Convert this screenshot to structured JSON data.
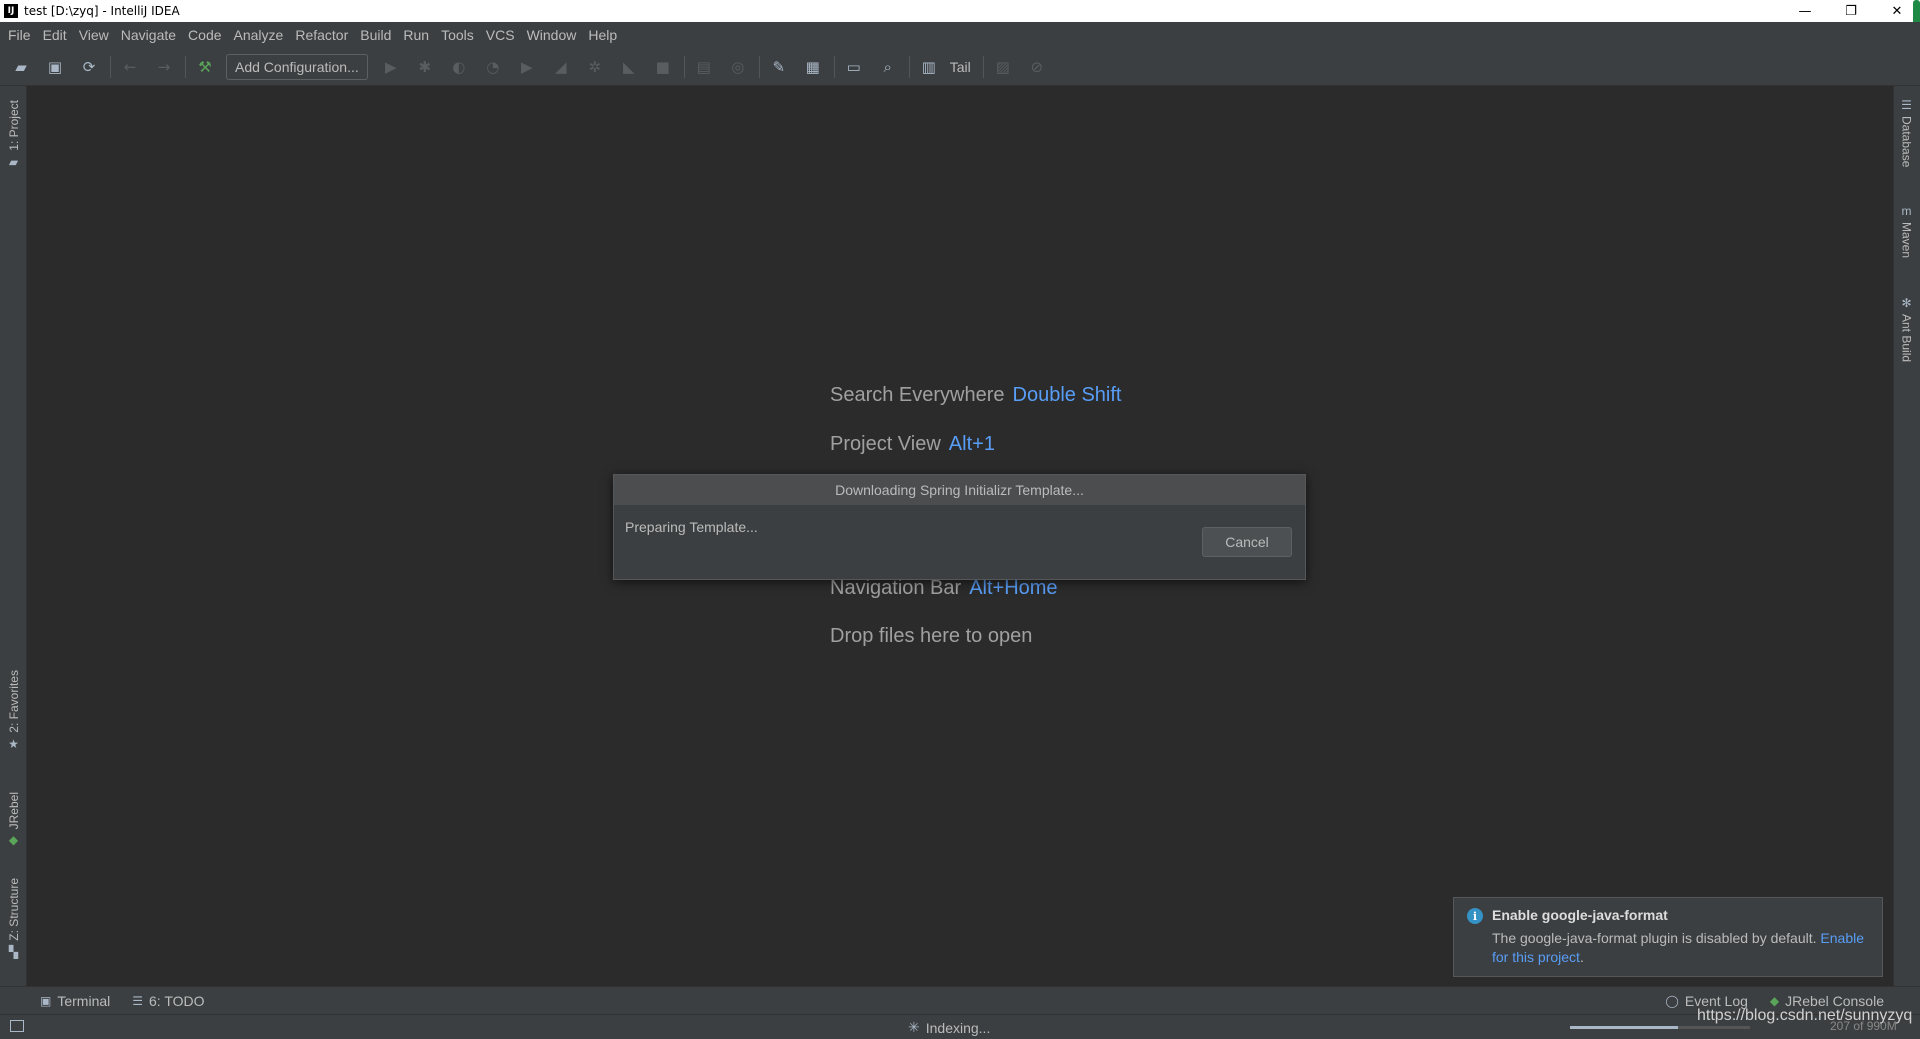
{
  "window": {
    "title": "test [D:\\zyq] - IntelliJ IDEA",
    "app_icon_label": "IJ",
    "minimize": "—",
    "restore": "❐",
    "close": "✕"
  },
  "menu": [
    "File",
    "Edit",
    "View",
    "Navigate",
    "Code",
    "Analyze",
    "Refactor",
    "Build",
    "Run",
    "Tools",
    "VCS",
    "Window",
    "Help"
  ],
  "toolbar": {
    "config_label": "Add Configuration...",
    "tail_label": "Tail"
  },
  "left_tabs": {
    "project": "1: Project",
    "favorites": "2: Favorites",
    "jrebel": "JRebel",
    "structure": "Z: Structure"
  },
  "right_tabs": {
    "database": "Database",
    "maven": "Maven",
    "ant": "Ant Build"
  },
  "editor_hints": {
    "search_label": "Search Everywhere",
    "search_key": "Double Shift",
    "project_label": "Project View",
    "project_key": "Alt+1",
    "nav_label": "Navigation Bar",
    "nav_key": "Alt+Home",
    "drop_label": "Drop files here to open"
  },
  "dialog": {
    "title": "Downloading Spring Initializr Template...",
    "message": "Preparing Template...",
    "cancel": "Cancel"
  },
  "notification": {
    "title": "Enable google-java-format",
    "body": "The google-java-format plugin is disabled by default.",
    "link": "Enable for this project",
    "link_suffix": "."
  },
  "bottom_tabs": {
    "terminal": "Terminal",
    "todo": "6: TODO",
    "event_log": "Event Log",
    "jrebel_console": "JRebel Console"
  },
  "status": {
    "indexing": "Indexing...",
    "memory": "207 of 990M",
    "progress": 0.6,
    "watermark": "https://blog.csdn.net/sunnyzyq"
  },
  "colors": {
    "accent_link": "#589df6",
    "background": "#2b2b2b",
    "panel": "#3c3f41"
  }
}
